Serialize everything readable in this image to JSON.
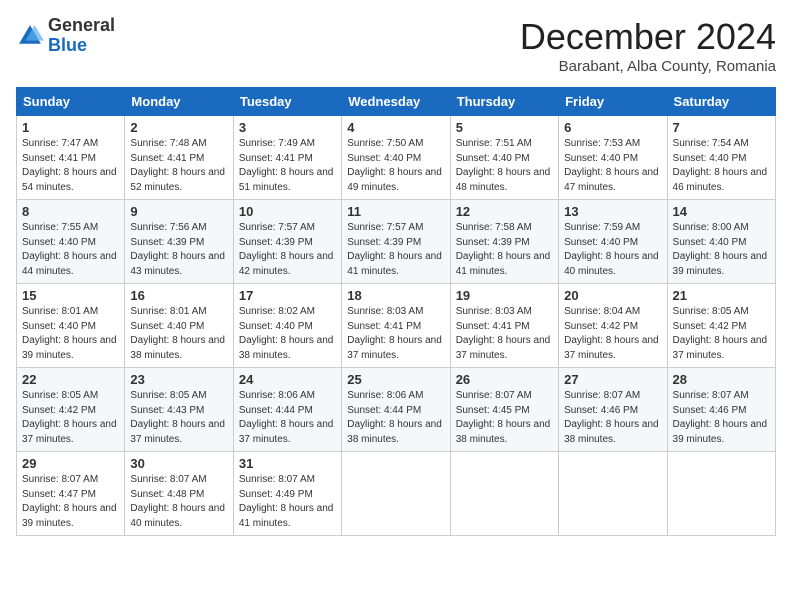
{
  "header": {
    "logo_general": "General",
    "logo_blue": "Blue",
    "month_title": "December 2024",
    "location": "Barabant, Alba County, Romania"
  },
  "days_of_week": [
    "Sunday",
    "Monday",
    "Tuesday",
    "Wednesday",
    "Thursday",
    "Friday",
    "Saturday"
  ],
  "weeks": [
    [
      {
        "day": "1",
        "sunrise": "7:47 AM",
        "sunset": "4:41 PM",
        "daylight": "8 hours and 54 minutes."
      },
      {
        "day": "2",
        "sunrise": "7:48 AM",
        "sunset": "4:41 PM",
        "daylight": "8 hours and 52 minutes."
      },
      {
        "day": "3",
        "sunrise": "7:49 AM",
        "sunset": "4:41 PM",
        "daylight": "8 hours and 51 minutes."
      },
      {
        "day": "4",
        "sunrise": "7:50 AM",
        "sunset": "4:40 PM",
        "daylight": "8 hours and 49 minutes."
      },
      {
        "day": "5",
        "sunrise": "7:51 AM",
        "sunset": "4:40 PM",
        "daylight": "8 hours and 48 minutes."
      },
      {
        "day": "6",
        "sunrise": "7:53 AM",
        "sunset": "4:40 PM",
        "daylight": "8 hours and 47 minutes."
      },
      {
        "day": "7",
        "sunrise": "7:54 AM",
        "sunset": "4:40 PM",
        "daylight": "8 hours and 46 minutes."
      }
    ],
    [
      {
        "day": "8",
        "sunrise": "7:55 AM",
        "sunset": "4:40 PM",
        "daylight": "8 hours and 44 minutes."
      },
      {
        "day": "9",
        "sunrise": "7:56 AM",
        "sunset": "4:39 PM",
        "daylight": "8 hours and 43 minutes."
      },
      {
        "day": "10",
        "sunrise": "7:57 AM",
        "sunset": "4:39 PM",
        "daylight": "8 hours and 42 minutes."
      },
      {
        "day": "11",
        "sunrise": "7:57 AM",
        "sunset": "4:39 PM",
        "daylight": "8 hours and 41 minutes."
      },
      {
        "day": "12",
        "sunrise": "7:58 AM",
        "sunset": "4:39 PM",
        "daylight": "8 hours and 41 minutes."
      },
      {
        "day": "13",
        "sunrise": "7:59 AM",
        "sunset": "4:40 PM",
        "daylight": "8 hours and 40 minutes."
      },
      {
        "day": "14",
        "sunrise": "8:00 AM",
        "sunset": "4:40 PM",
        "daylight": "8 hours and 39 minutes."
      }
    ],
    [
      {
        "day": "15",
        "sunrise": "8:01 AM",
        "sunset": "4:40 PM",
        "daylight": "8 hours and 39 minutes."
      },
      {
        "day": "16",
        "sunrise": "8:01 AM",
        "sunset": "4:40 PM",
        "daylight": "8 hours and 38 minutes."
      },
      {
        "day": "17",
        "sunrise": "8:02 AM",
        "sunset": "4:40 PM",
        "daylight": "8 hours and 38 minutes."
      },
      {
        "day": "18",
        "sunrise": "8:03 AM",
        "sunset": "4:41 PM",
        "daylight": "8 hours and 37 minutes."
      },
      {
        "day": "19",
        "sunrise": "8:03 AM",
        "sunset": "4:41 PM",
        "daylight": "8 hours and 37 minutes."
      },
      {
        "day": "20",
        "sunrise": "8:04 AM",
        "sunset": "4:42 PM",
        "daylight": "8 hours and 37 minutes."
      },
      {
        "day": "21",
        "sunrise": "8:05 AM",
        "sunset": "4:42 PM",
        "daylight": "8 hours and 37 minutes."
      }
    ],
    [
      {
        "day": "22",
        "sunrise": "8:05 AM",
        "sunset": "4:42 PM",
        "daylight": "8 hours and 37 minutes."
      },
      {
        "day": "23",
        "sunrise": "8:05 AM",
        "sunset": "4:43 PM",
        "daylight": "8 hours and 37 minutes."
      },
      {
        "day": "24",
        "sunrise": "8:06 AM",
        "sunset": "4:44 PM",
        "daylight": "8 hours and 37 minutes."
      },
      {
        "day": "25",
        "sunrise": "8:06 AM",
        "sunset": "4:44 PM",
        "daylight": "8 hours and 38 minutes."
      },
      {
        "day": "26",
        "sunrise": "8:07 AM",
        "sunset": "4:45 PM",
        "daylight": "8 hours and 38 minutes."
      },
      {
        "day": "27",
        "sunrise": "8:07 AM",
        "sunset": "4:46 PM",
        "daylight": "8 hours and 38 minutes."
      },
      {
        "day": "28",
        "sunrise": "8:07 AM",
        "sunset": "4:46 PM",
        "daylight": "8 hours and 39 minutes."
      }
    ],
    [
      {
        "day": "29",
        "sunrise": "8:07 AM",
        "sunset": "4:47 PM",
        "daylight": "8 hours and 39 minutes."
      },
      {
        "day": "30",
        "sunrise": "8:07 AM",
        "sunset": "4:48 PM",
        "daylight": "8 hours and 40 minutes."
      },
      {
        "day": "31",
        "sunrise": "8:07 AM",
        "sunset": "4:49 PM",
        "daylight": "8 hours and 41 minutes."
      },
      null,
      null,
      null,
      null
    ]
  ]
}
